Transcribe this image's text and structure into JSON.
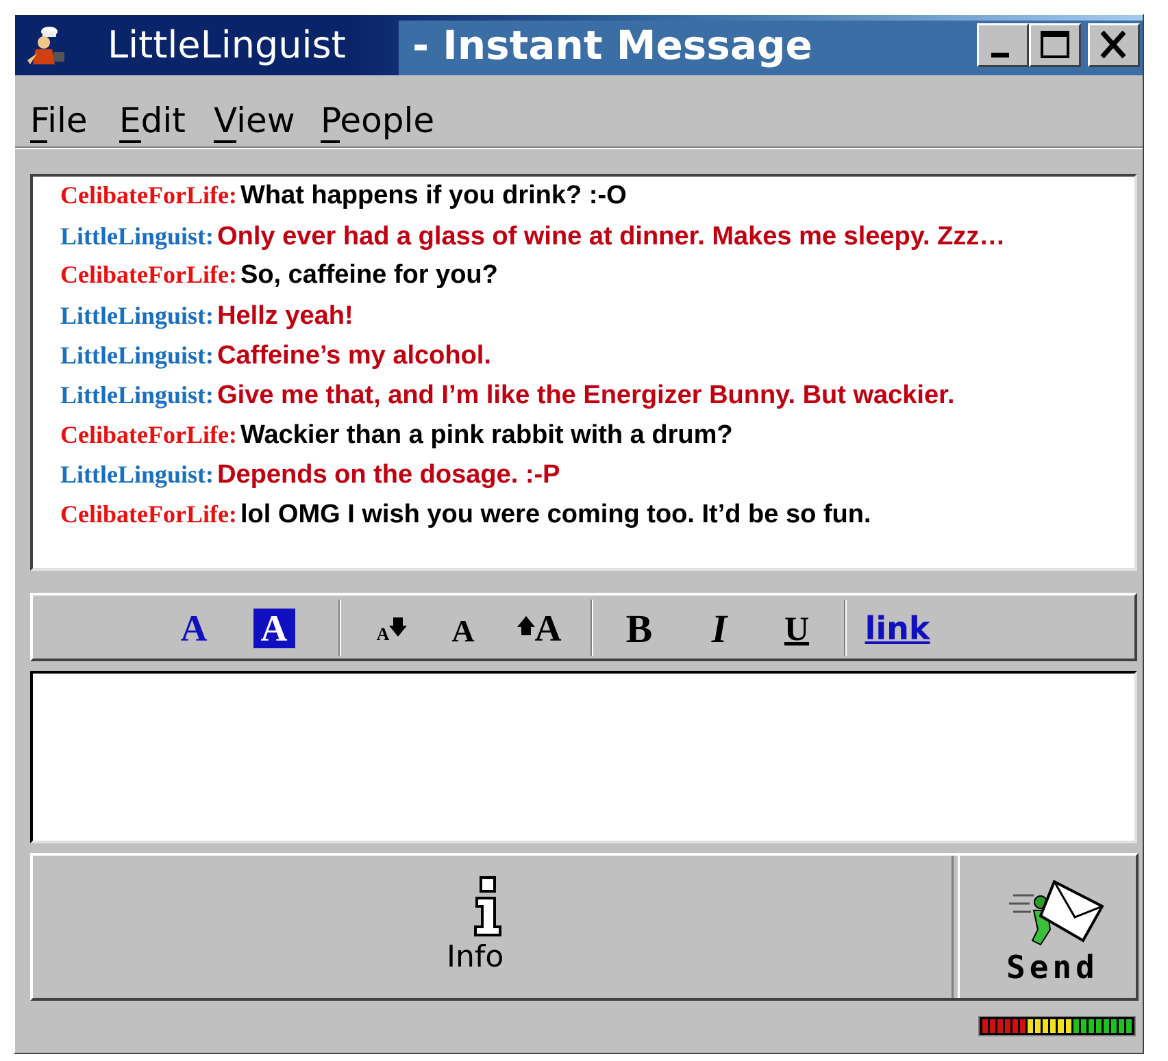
{
  "window": {
    "title_user": "LittleLinguist",
    "title_rest": "- Instant Message",
    "controls": [
      "minimize-icon",
      "maximize-icon",
      "close-icon"
    ]
  },
  "menu": [
    {
      "label": "File",
      "mnemonic": "F"
    },
    {
      "label": "Edit",
      "mnemonic": "E"
    },
    {
      "label": "View",
      "mnemonic": "V"
    },
    {
      "label": "People",
      "mnemonic": "P"
    }
  ],
  "colors": {
    "celibate_sender": "#e81010",
    "linguist_sender": "#1a6fbf",
    "linguist_text": "#c00010",
    "default_text": "#000000",
    "toolbar_blue": "#1010c0"
  },
  "messages": [
    {
      "sender": "CelibateForLife:",
      "text": "What happens if you drink? :-O",
      "who": "celibate"
    },
    {
      "sender": "LittleLinguist:",
      "text": "Only ever had a glass of wine at dinner. Makes me sleepy. Zzz…",
      "who": "linguist"
    },
    {
      "sender": "CelibateForLife:",
      "text": "So, caffeine for you?",
      "who": "celibate"
    },
    {
      "sender": "LittleLinguist:",
      "text": "Hellz yeah!",
      "who": "linguist"
    },
    {
      "sender": "LittleLinguist:",
      "text": "Caffeine’s my alcohol.",
      "who": "linguist"
    },
    {
      "sender": "LittleLinguist:",
      "text": "Give me that, and I’m like the Energizer Bunny. But wackier.",
      "who": "linguist"
    },
    {
      "sender": "CelibateForLife:",
      "text": "Wackier than a pink rabbit with a drum?",
      "who": "celibate"
    },
    {
      "sender": "LittleLinguist:",
      "text": "Depends on the dosage. :-P",
      "who": "linguist"
    },
    {
      "sender": "CelibateForLife:",
      "text": "lol OMG I wish you were coming too. It’d be so fun.",
      "who": "celibate"
    }
  ],
  "toolbar": {
    "text_color_icon": "A",
    "bg_color_icon": "A",
    "font_size_small": "A",
    "font_size_normal": "A",
    "font_size_large": "A",
    "bold_icon": "B",
    "italic_icon": "I",
    "underline_icon": "U",
    "link_label": "link"
  },
  "input": {
    "value": ""
  },
  "buttons": {
    "info_label": "Info",
    "send_label": "Send"
  },
  "level_meter": {
    "segments": 20,
    "filled": 20
  }
}
